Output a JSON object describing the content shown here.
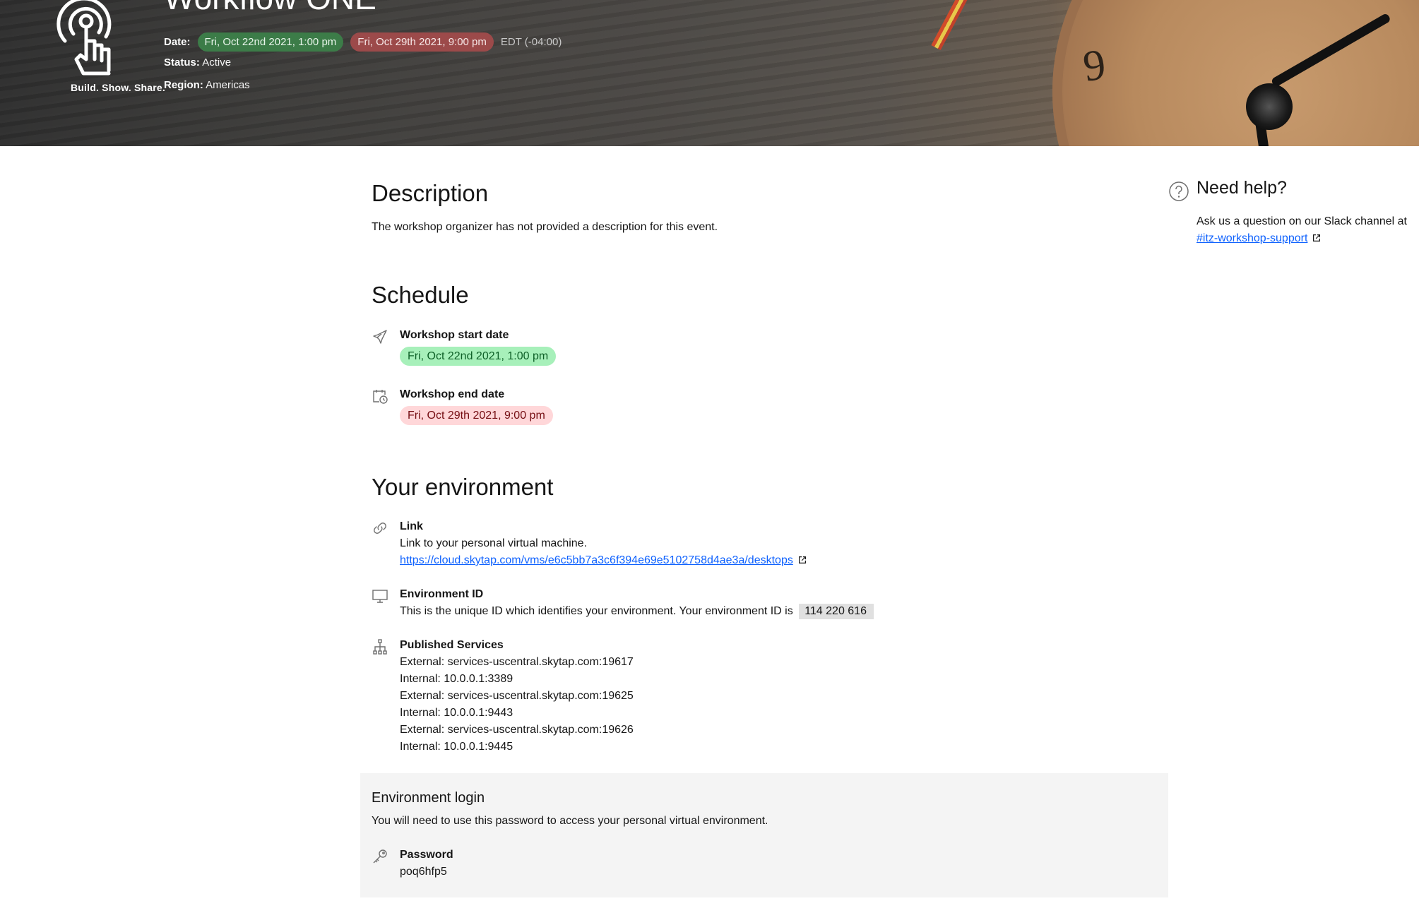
{
  "header": {
    "logo_caption": "Build. Show. Share.",
    "title": "Workflow ONE",
    "date_label": "Date:",
    "start_date": "Fri, Oct 22nd 2021, 1:00 pm",
    "end_date": "Fri, Oct 29th 2021, 9:00 pm",
    "timezone": "EDT (-04:00)",
    "status_label": "Status:",
    "status_value": "Active",
    "region_label": "Region:",
    "region_value": "Americas"
  },
  "description": {
    "heading": "Description",
    "text": "The workshop organizer has not provided a description for this event."
  },
  "schedule": {
    "heading": "Schedule",
    "start_label": "Workshop start date",
    "start_value": "Fri, Oct 22nd 2021, 1:00 pm",
    "end_label": "Workshop end date",
    "end_value": "Fri, Oct 29th 2021, 9:00 pm"
  },
  "environment": {
    "heading": "Your environment",
    "link_label": "Link",
    "link_desc": "Link to your personal virtual machine.",
    "link_url": "https://cloud.skytap.com/vms/e6c5bb7a3c6f394e69e5102758d4ae3a/desktops",
    "env_id_label": "Environment ID",
    "env_id_desc": "This is the unique ID which identifies your environment. Your environment ID is",
    "env_id_value": "114 220 616",
    "services_label": "Published Services",
    "services": [
      "External: services-uscentral.skytap.com:19617",
      "Internal: 10.0.0.1:3389",
      "External: services-uscentral.skytap.com:19625",
      "Internal: 10.0.0.1:9443",
      "External: services-uscentral.skytap.com:19626",
      "Internal: 10.0.0.1:9445"
    ]
  },
  "login": {
    "heading": "Environment login",
    "text": "You will need to use this password to access your personal virtual environment.",
    "password_label": "Password",
    "password_value": "poq6hfp5"
  },
  "help": {
    "title": "Need help?",
    "text": "Ask us a question on our Slack channel at",
    "channel": "#itz-workshop-support"
  },
  "colors": {
    "start_tag_dark": "#3c7c48",
    "end_tag_dark": "#9c4a4a",
    "start_tag_light": "#a7f0ba",
    "end_tag_light": "#ffd7d9",
    "link": "#0f62fe",
    "login_bg": "#f4f4f4"
  },
  "icons": [
    "touch-logo-icon",
    "rocket-icon",
    "calendar-clock-icon",
    "link-icon",
    "monitor-icon",
    "network-tree-icon",
    "key-icon",
    "help-circle-icon",
    "external-link-icon"
  ]
}
